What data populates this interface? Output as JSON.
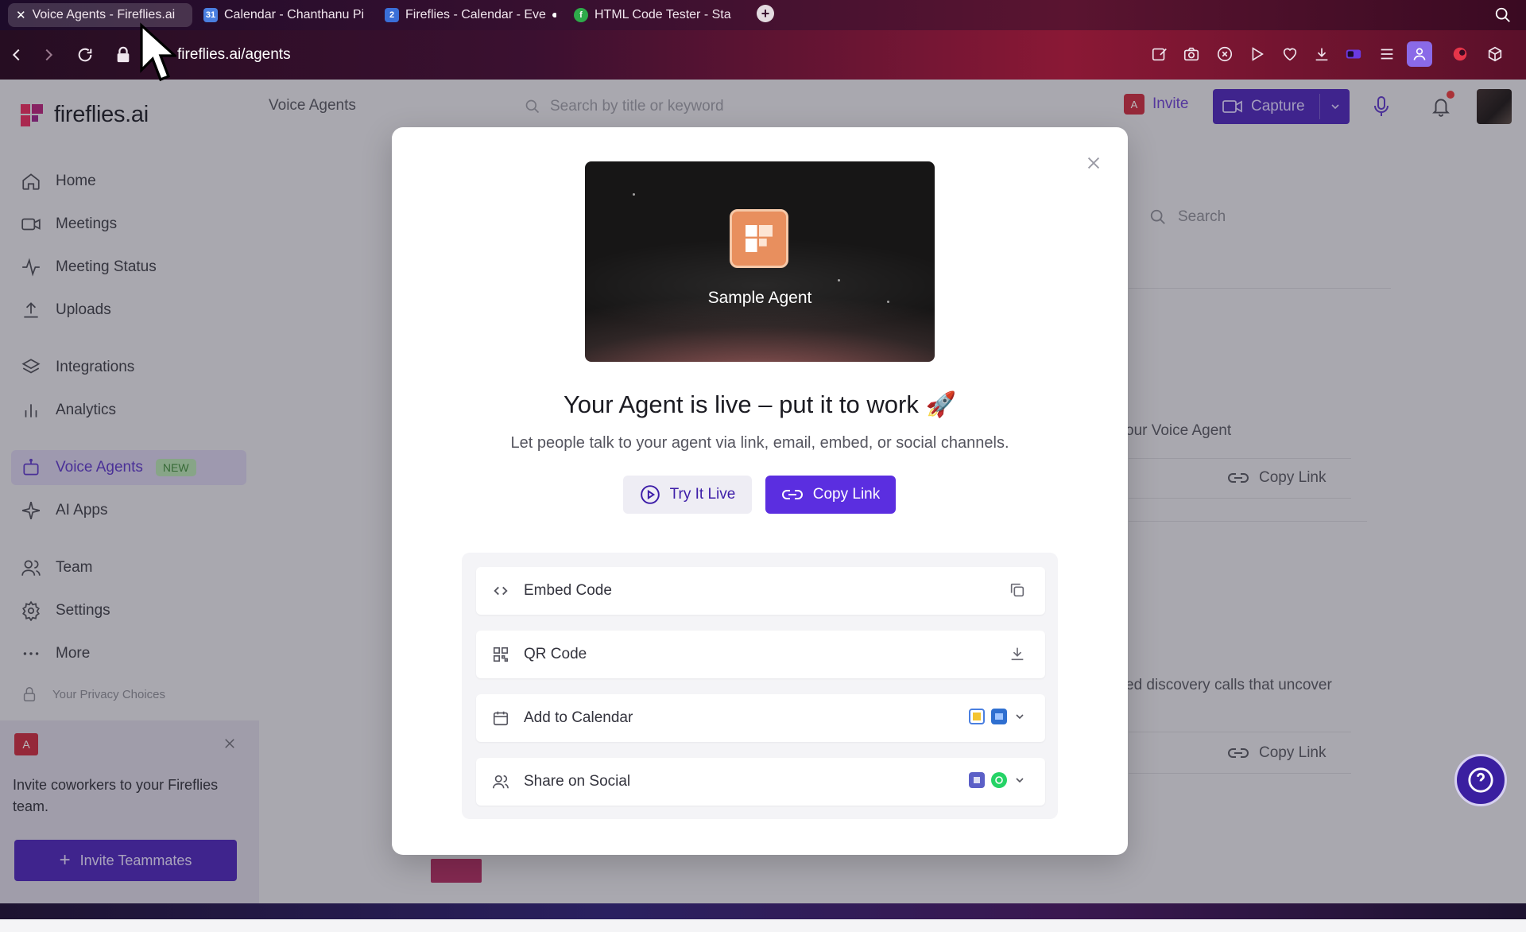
{
  "browser": {
    "tabs": [
      {
        "title": "Voice Agents - Fireflies.ai",
        "active": true
      },
      {
        "title": "Calendar - Chanthanu Pi",
        "active": false
      },
      {
        "title": "Fireflies - Calendar - Eve",
        "active": false
      },
      {
        "title": "HTML Code Tester - Sta",
        "active": false
      }
    ],
    "url": "fireflies.ai/agents"
  },
  "app": {
    "logo_text": "fireflies.ai",
    "breadcrumb": "Voice Agents",
    "search_placeholder": "Search by title or keyword",
    "invite_label": "Invite",
    "invite_avatar": "A",
    "capture_label": "Capture"
  },
  "sidebar": {
    "items": [
      {
        "label": "Home",
        "icon": "home-icon"
      },
      {
        "label": "Meetings",
        "icon": "video-icon"
      },
      {
        "label": "Meeting Status",
        "icon": "pulse-icon"
      },
      {
        "label": "Uploads",
        "icon": "upload-icon"
      },
      {
        "label": "Integrations",
        "icon": "layers-icon"
      },
      {
        "label": "Analytics",
        "icon": "bar-chart-icon"
      },
      {
        "label": "Voice Agents",
        "icon": "robot-icon",
        "badge": "NEW",
        "active": true
      },
      {
        "label": "AI Apps",
        "icon": "sparkle-icon"
      },
      {
        "label": "Team",
        "icon": "team-icon"
      },
      {
        "label": "Settings",
        "icon": "gear-icon"
      },
      {
        "label": "More",
        "icon": "dots-icon"
      }
    ],
    "privacy_label": "Your Privacy Choices",
    "invite_card": {
      "avatar": "A",
      "message": "Invite coworkers to your Fireflies team.",
      "button_label": "Invite Teammates"
    }
  },
  "background": {
    "search_placeholder": "Search",
    "text_1": "our Voice Agent",
    "copy_link_1": "Copy Link",
    "text_2": "ed discovery calls that uncover",
    "copy_link_2": "Copy Link"
  },
  "modal": {
    "hero_title": "Sample Agent",
    "title": "Your Agent is live – put it to work 🚀",
    "subtitle": "Let people talk to your agent via link, email, embed, or social channels.",
    "try_live_label": "Try It Live",
    "copy_link_label": "Copy Link",
    "options": [
      {
        "label": "Embed Code",
        "icon": "code-icon",
        "action_icon": "copy-icon"
      },
      {
        "label": "QR Code",
        "icon": "qr-code-icon",
        "action_icon": "download-icon"
      },
      {
        "label": "Add to Calendar",
        "icon": "calendar-icon",
        "action_icon": "chevron-down-icon"
      },
      {
        "label": "Share on Social",
        "icon": "users-icon",
        "action_icon": "chevron-down-icon"
      }
    ]
  },
  "colors": {
    "brand_purple": "#5b2ee0",
    "active_nav": "#5a34c8",
    "new_badge_bg": "#b4e0b0"
  }
}
